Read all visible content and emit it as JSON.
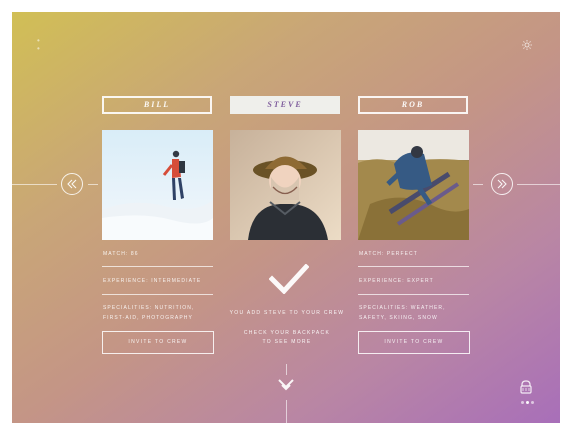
{
  "icons": {
    "top_left": "dots-icon",
    "top_right": "gear-icon",
    "left_nav": "double-chevron-left-icon",
    "right_nav": "double-chevron-right-icon",
    "confirm": "check-icon",
    "down_nav": "double-chevron-down-icon",
    "bottom_right": "lock-icon"
  },
  "crew": {
    "selected_index": 1,
    "members": [
      {
        "name": "BILL",
        "match": "MATCH: 86",
        "experience": "EXPERIENCE: INTERMEDIATE",
        "specialities_line1": "SPECIALITIES: NUTRITION,",
        "specialities_line2": "FIRST-AID, PHOTOGRAPHY",
        "button_label": "INVITE TO CREW"
      },
      {
        "name": "STEVE",
        "message_line1": "YOU ADD STEVE TO YOUR CREW",
        "message_line2": "CHECK YOUR BACKPACK",
        "message_line3": "TO SEE MORE"
      },
      {
        "name": "ROB",
        "match": "MATCH: PERFECT",
        "experience": "EXPERIENCE: EXPERT",
        "specialities_line1": "SPECIALITIES: WEATHER,",
        "specialities_line2": "SAFETY, SKIING, SNOW",
        "button_label": "INVITE TO CREW"
      }
    ]
  },
  "colors": {
    "selected_card_bg": "#efefeb",
    "selected_card_text": "#7e5c9c",
    "gradient_top_left": "#d1bf55",
    "gradient_bottom_right": "#a86fb9"
  }
}
